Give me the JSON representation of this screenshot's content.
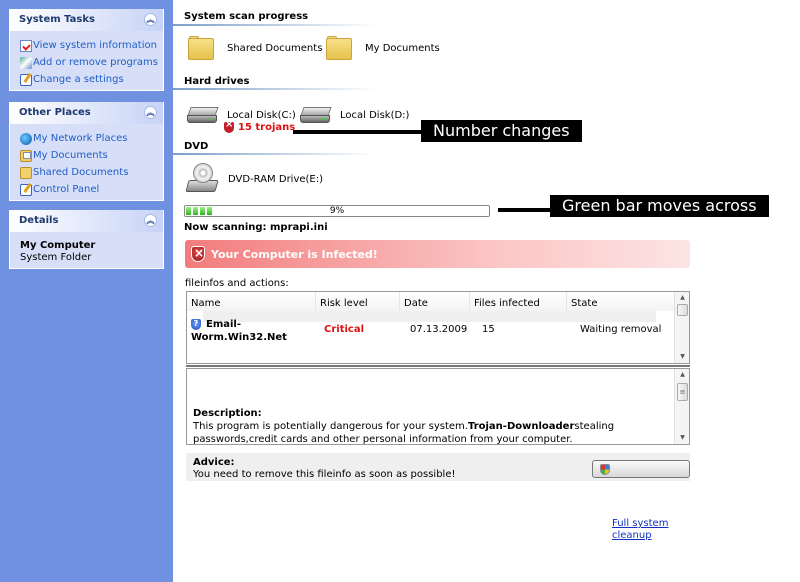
{
  "sidebar": {
    "system_tasks": {
      "title": "System Tasks",
      "items": [
        {
          "label": "View system information",
          "icon": "system-info-icon"
        },
        {
          "label": "Add or remove programs",
          "icon": "add-remove-programs-icon"
        },
        {
          "label": "Change a settings",
          "icon": "settings-icon"
        }
      ]
    },
    "other_places": {
      "title": "Other Places",
      "items": [
        {
          "label": "My Network Places",
          "icon": "network-places-icon"
        },
        {
          "label": "My Documents",
          "icon": "my-documents-icon"
        },
        {
          "label": "Shared Documents",
          "icon": "shared-documents-icon"
        },
        {
          "label": "Control Panel",
          "icon": "control-panel-icon"
        }
      ]
    },
    "details": {
      "title": "Details",
      "name": "My Computer",
      "type": "System Folder"
    }
  },
  "main": {
    "scan_section_title": "System scan progress",
    "folders": [
      {
        "label": "Shared Documents",
        "icon": "folder-icon"
      },
      {
        "label": "My Documents",
        "icon": "folder-icon"
      }
    ],
    "hard_drives_title": "Hard drives",
    "drives": [
      {
        "label": "Local Disk(C:)",
        "icon": "hard-disk-icon"
      },
      {
        "label": "Local Disk(D:)",
        "icon": "hard-disk-icon"
      }
    ],
    "trojans_label": "15 trojans",
    "dvd_title": "DVD",
    "dvd_drive": {
      "label": "DVD-RAM Drive(E:)",
      "icon": "dvd-drive-icon"
    },
    "progress": {
      "percent": 9,
      "label": "9%"
    },
    "now_scanning": "Now scanning: mprapi.ini",
    "alert_text": "Your Computer is Infected!",
    "fileinfos_label": "fileinfos and actions:",
    "table": {
      "columns": [
        "Name",
        "Risk level",
        "Date",
        "Files infected",
        "State"
      ],
      "rows": [
        {
          "name_line1": "Email-",
          "name_line2": "Worm.Win32.Net",
          "risk": "Critical",
          "date": "07.13.2009",
          "files_infected": "15",
          "state": "Waiting removal"
        }
      ]
    },
    "description": {
      "title": "Description:",
      "text_before": "This program is potentially dangerous for your system.",
      "bold": "Trojan-Downloader",
      "text_after": "stealing passwords,credit cards and other personal information from your computer."
    },
    "advice": {
      "title": "Advice:",
      "message": "You need to remove this fileinfo as soon as possible!"
    },
    "cleanup_link": "Full system cleanup"
  },
  "annotations": {
    "number_changes": "Number changes",
    "green_bar": "Green bar moves across"
  },
  "colors": {
    "sidebar_bg": "#7090e0",
    "link_blue": "#215dc6",
    "critical_red": "#e01010",
    "progress_green": "#2fb51d"
  }
}
